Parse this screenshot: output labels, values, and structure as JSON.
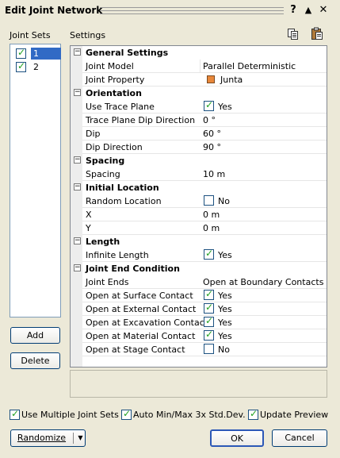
{
  "window": {
    "title": "Edit Joint Network",
    "help_glyph": "?",
    "collapse_glyph": "▲",
    "close_glyph": "✕"
  },
  "joint_sets": {
    "label": "Joint Sets",
    "items": [
      {
        "label": "1",
        "checked": true,
        "selected": true
      },
      {
        "label": "2",
        "checked": true,
        "selected": false
      }
    ],
    "add_label": "Add",
    "delete_label": "Delete"
  },
  "settings": {
    "label": "Settings",
    "sections": [
      {
        "title": "General Settings",
        "rows": [
          {
            "name": "Joint Model",
            "value": "Parallel Deterministic"
          },
          {
            "name": "Joint Property",
            "value": "Junta",
            "swatch": "#e8873a"
          }
        ]
      },
      {
        "title": "Orientation",
        "rows": [
          {
            "name": "Use Trace Plane",
            "value": "Yes",
            "checkbox": true,
            "checked": true
          },
          {
            "name": "Trace Plane Dip Direction",
            "value": "0 °"
          },
          {
            "name": "Dip",
            "value": "60 °"
          },
          {
            "name": "Dip Direction",
            "value": "90 °"
          }
        ]
      },
      {
        "title": "Spacing",
        "rows": [
          {
            "name": "Spacing",
            "value": "10 m"
          }
        ]
      },
      {
        "title": "Initial Location",
        "rows": [
          {
            "name": "Random Location",
            "value": "No",
            "checkbox": true,
            "checked": false
          },
          {
            "name": "X",
            "value": "0 m"
          },
          {
            "name": "Y",
            "value": "0 m"
          }
        ]
      },
      {
        "title": "Length",
        "rows": [
          {
            "name": "Infinite Length",
            "value": "Yes",
            "checkbox": true,
            "checked": true
          }
        ]
      },
      {
        "title": "Joint End Condition",
        "rows": [
          {
            "name": "Joint Ends",
            "value": "Open at Boundary Contacts"
          },
          {
            "name": "Open at Surface Contact",
            "value": "Yes",
            "checkbox": true,
            "checked": true
          },
          {
            "name": "Open at External Contact",
            "value": "Yes",
            "checkbox": true,
            "checked": true
          },
          {
            "name": "Open at Excavation Contact",
            "value": "Yes",
            "checkbox": true,
            "checked": true
          },
          {
            "name": "Open at Material Contact",
            "value": "Yes",
            "checkbox": true,
            "checked": true
          },
          {
            "name": "Open at Stage Contact",
            "value": "No",
            "checkbox": true,
            "checked": false
          }
        ]
      }
    ]
  },
  "options": {
    "use_multiple": {
      "label": "Use Multiple Joint Sets",
      "checked": true
    },
    "auto_minmax": {
      "label": "Auto Min/Max 3x Std.Dev.",
      "checked": true
    },
    "update_preview": {
      "label": "Update Preview",
      "checked": true
    }
  },
  "footer": {
    "randomize_label": "Randomize",
    "ok_label": "OK",
    "cancel_label": "Cancel"
  },
  "icons": {
    "copy": "copy-icon",
    "paste": "paste-icon"
  }
}
